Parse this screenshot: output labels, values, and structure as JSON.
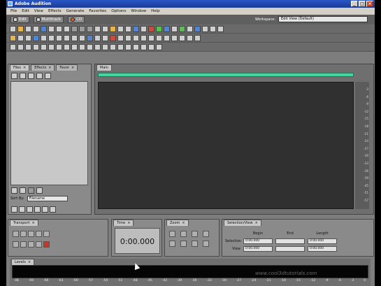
{
  "window": {
    "title": "Adobe Audition"
  },
  "menu": [
    "File",
    "Edit",
    "View",
    "Effects",
    "Generate",
    "Favorites",
    "Options",
    "Window",
    "Help"
  ],
  "views": [
    {
      "label": "Edit",
      "icon": "edit-view-icon"
    },
    {
      "label": "Multitrack",
      "icon": "multitrack-view-icon"
    },
    {
      "label": "CD",
      "icon": "cd-view-icon"
    }
  ],
  "workspace": {
    "label": "Workspace:",
    "value": "Edit View (Default)"
  },
  "files_panel": {
    "tabs": [
      "Files",
      "Effects",
      "Favor"
    ],
    "sort_label": "Sort By:",
    "sort_value": "Filename"
  },
  "main_panel": {
    "tab": "Main"
  },
  "ruler_ticks": [
    "-3",
    "-6",
    "-9",
    "-12",
    "-15",
    "-18",
    "-21",
    "-24",
    "-27",
    "-30",
    "-33",
    "-36",
    "-39",
    "-45",
    "-51",
    "-57"
  ],
  "transport": {
    "tab": "Transport"
  },
  "time": {
    "tab": "Time",
    "value": "0:00.000"
  },
  "zoom": {
    "tab": "Zoom"
  },
  "selection": {
    "tab": "Selection/View",
    "headers": [
      "Begin",
      "End",
      "Length"
    ],
    "rows": [
      {
        "label": "Selection",
        "begin": "0:00.000",
        "end": "",
        "length": "0:00.000"
      },
      {
        "label": "View",
        "begin": "0:00.000",
        "end": "",
        "length": "0:00.000"
      }
    ]
  },
  "levels": {
    "tab": "Levels",
    "db": [
      "dB",
      "-69",
      "-66",
      "-63",
      "-60",
      "-57",
      "-54",
      "-51",
      "-48",
      "-45",
      "-42",
      "-39",
      "-36",
      "-33",
      "-30",
      "-27",
      "-24",
      "-21",
      "-18",
      "-15",
      "-12",
      "-9",
      "-6",
      "-3",
      "0"
    ]
  },
  "watermark": "www.cool3dtutorials.com",
  "colors": {
    "overview": "#45d6a0",
    "waveform_bg": "#303030",
    "record": "#c0392b"
  }
}
